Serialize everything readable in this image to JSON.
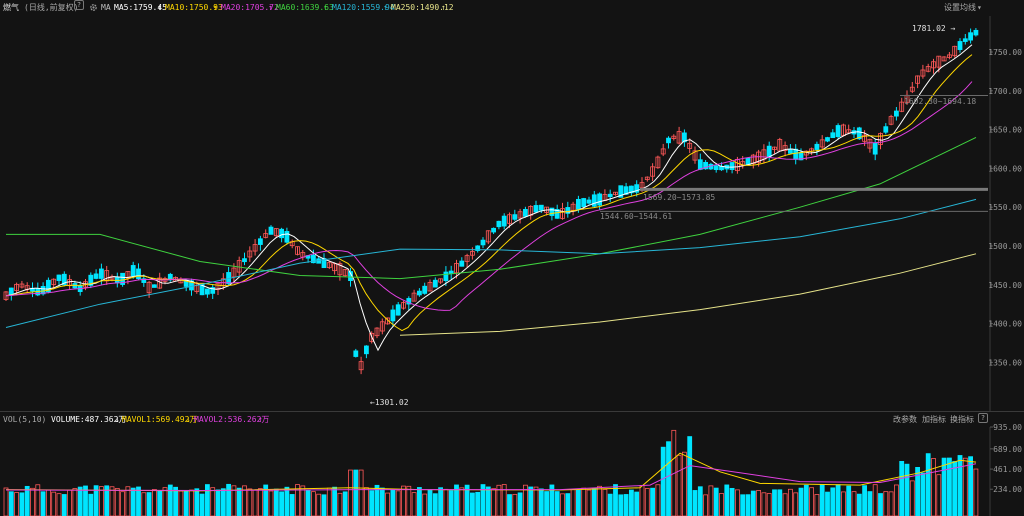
{
  "header": {
    "title": "燃气",
    "mode": "(日线,前复权)",
    "help_icon": "?",
    "gear_icon": "gear-icon",
    "ma_label": "MA",
    "ma5": "MA5:1759.45",
    "ma10": "MA10:1750.93",
    "ma20": "MA20:1705.72",
    "ma60": "MA60:1639.63",
    "ma120": "MA120:1559.94",
    "ma250": "MA250:1490.12",
    "up_arrow": "↑",
    "settings_label": "设置均线",
    "dropdown_icon": "▾"
  },
  "price_axis": [
    "1750.00",
    "1700.00",
    "1650.00",
    "1600.00",
    "1550.00",
    "1500.00",
    "1450.00",
    "1400.00",
    "1350.00"
  ],
  "annotations": {
    "high": "1781.02",
    "low": "1301.02",
    "range1": "1602.30~1694.18",
    "range2": "1569.20~1573.85",
    "range3": "1544.60~1544.61"
  },
  "volume_header": {
    "label": "VOL(5,10)",
    "volume": "VOLUME:487.362万",
    "mavol1": "MAVOL1:569.492万",
    "mavol2": "MAVOL2:536.262万",
    "down_arrow": "↓",
    "up_arrow": "↑",
    "btn_params": "改参数",
    "btn_add_indicator": "加指标",
    "btn_switch_indicator": "换指标"
  },
  "volume_axis": [
    "935.00",
    "689.00",
    "461.00",
    "234.00"
  ],
  "colors": {
    "up": "#ff5858",
    "down": "#00e5ff",
    "ma5": "#ffffff",
    "ma10": "#ffd800",
    "ma20": "#e040e0",
    "ma60": "#3fd23f",
    "ma120": "#27b6d6",
    "ma250": "#e6e38a"
  }
}
